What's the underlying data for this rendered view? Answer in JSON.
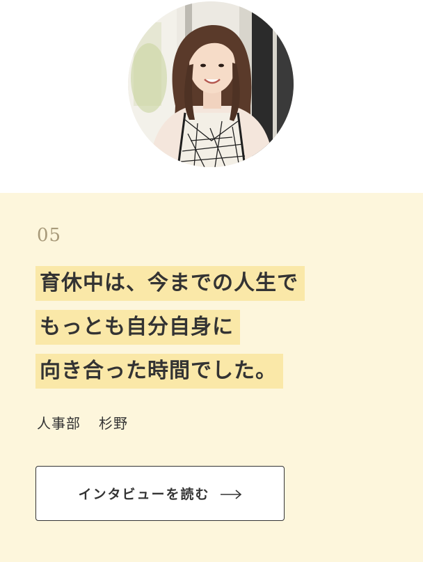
{
  "profile": {
    "photo_icon": "person-photo"
  },
  "interview": {
    "number": "05",
    "headline_lines": [
      "育休中は、今までの人生で",
      "もっとも自分自身に",
      "向き合った時間でした。"
    ],
    "department": "人事部",
    "name": "杉野"
  },
  "button": {
    "label": "インタビューを読む",
    "icon": "arrow-right-icon"
  },
  "colors": {
    "card_background": "#fdf6dc",
    "highlight": "#fae8a8",
    "number": "#a89a7a",
    "text": "#333333"
  }
}
